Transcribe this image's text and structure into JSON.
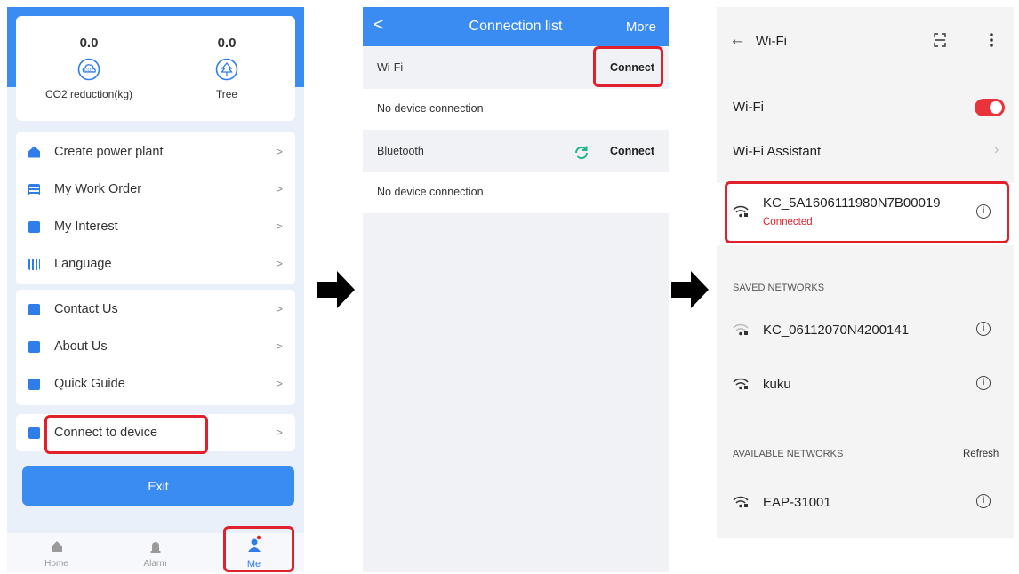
{
  "panel1": {
    "stats": [
      {
        "value": "0.0",
        "label": "CO2 reduction(kg)",
        "icon": "co2-cloud-icon"
      },
      {
        "value": "0.0",
        "label": "Tree",
        "icon": "tree-icon"
      }
    ],
    "menu_group1": [
      {
        "label": "Create power plant",
        "icon": "home-icon"
      },
      {
        "label": "My Work Order",
        "icon": "work-order-icon"
      },
      {
        "label": "My Interest",
        "icon": "star-icon"
      },
      {
        "label": "Language",
        "icon": "language-icon"
      }
    ],
    "menu_group2": [
      {
        "label": "Contact Us",
        "icon": "chat-icon"
      },
      {
        "label": "About Us",
        "icon": "info-icon"
      },
      {
        "label": "Quick Guide",
        "icon": "guide-icon"
      }
    ],
    "connect_label": "Connect to device",
    "chevron": ">",
    "exit_label": "Exit",
    "tabs": [
      {
        "label": "Home",
        "icon": "home-icon"
      },
      {
        "label": "Alarm",
        "icon": "alarm-icon"
      },
      {
        "label": "Me",
        "icon": "person-icon"
      }
    ],
    "accent": "#3a8cf2",
    "highlight": "#e0202a"
  },
  "panel2": {
    "back": "<",
    "title": "Connection list",
    "more": "More",
    "wifi_label": "Wi-Fi",
    "wifi_connect": "Connect",
    "no_device_1": "No device connection",
    "bt_label": "Bluetooth",
    "bt_connect": "Connect",
    "no_device_2": "No device connection"
  },
  "panel3": {
    "back": "←",
    "title": "Wi-Fi",
    "wifi_toggle_label": "Wi-Fi",
    "wifi_on": true,
    "assistant": "Wi-Fi Assistant",
    "connected_network": "KC_5A1606111980N7B00019",
    "connected_status": "Connected",
    "saved_header": "SAVED NETWORKS",
    "saved": [
      "KC_06112070N4200141",
      "kuku"
    ],
    "available_header": "AVAILABLE NETWORKS",
    "refresh": "Refresh",
    "available": [
      "EAP-31001"
    ],
    "info_glyph": "i",
    "toggle_color": "#e8333b"
  }
}
